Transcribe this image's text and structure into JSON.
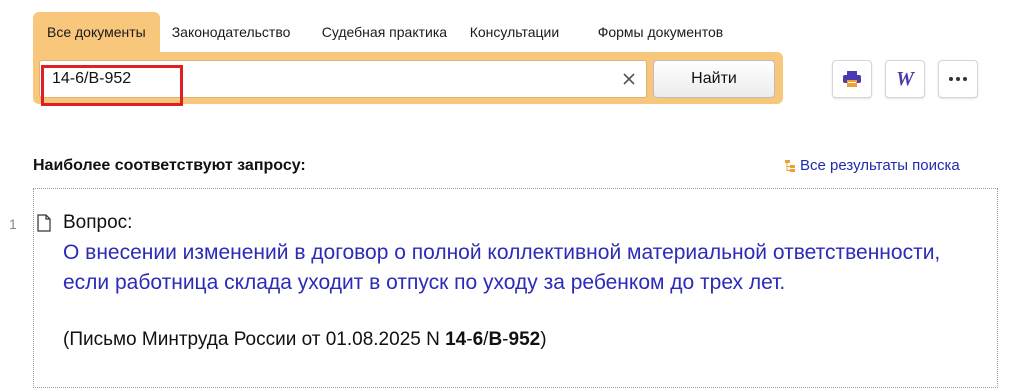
{
  "tabs": [
    {
      "label": "Все документы",
      "active": true
    },
    {
      "label": "Законодательство",
      "active": false
    },
    {
      "label": "Судебная практика",
      "active": false
    },
    {
      "label": "Консультации",
      "active": false
    },
    {
      "label": "Формы документов",
      "active": false
    }
  ],
  "search": {
    "value": "14-6/В-952",
    "button_label": "Найти"
  },
  "toolbar": {
    "print_icon": "printer-icon",
    "word_icon": "word-export-icon",
    "word_glyph": "W",
    "more_icon": "more-dots-icon"
  },
  "results": {
    "heading": "Наиболее соответствуют запросу:",
    "all_link": "Все результаты поиска",
    "items": [
      {
        "number": "1",
        "type_label": "Вопрос:",
        "title": "О внесении изменений в договор о полной коллективной материальной ответственности, если работница склада уходит в отпуск по уходу за ребенком до трех лет.",
        "source_prefix": "(Письмо Минтруда России от 01.08.2025 N ",
        "source_num_a": "14",
        "source_dash_a": "-",
        "source_num_b": "6",
        "source_slash": "/",
        "source_num_c": "В",
        "source_dash_b": "-",
        "source_num_d": "952",
        "source_suffix": ")"
      }
    ]
  },
  "colors": {
    "accent": "#f8c77c",
    "link": "#2b2bb8",
    "highlight": "#e02020"
  }
}
